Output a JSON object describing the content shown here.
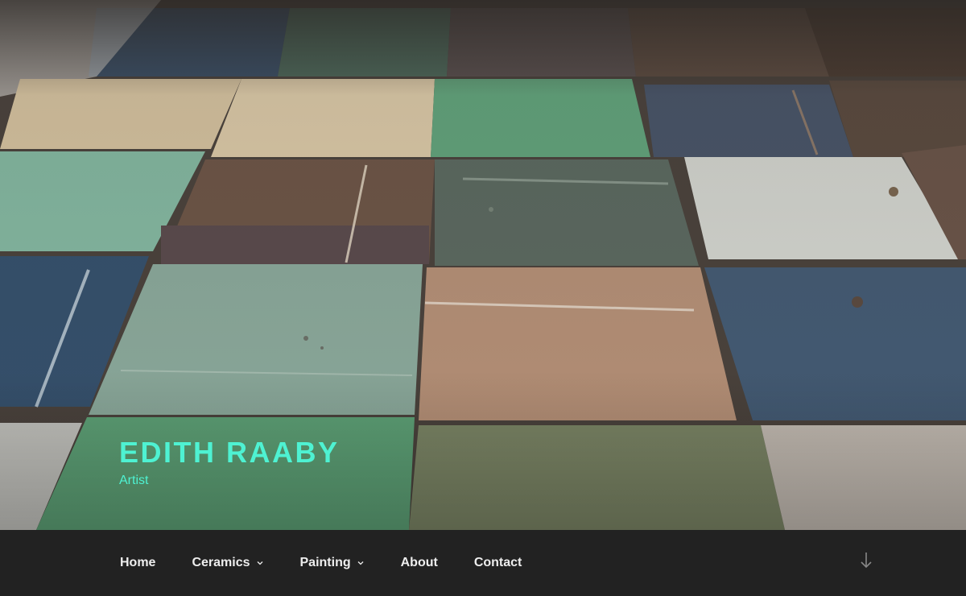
{
  "site": {
    "title": "EDITH RAABY",
    "tagline": "Artist"
  },
  "header_image": {
    "subject": "Glazed ceramic tiles",
    "colors": {
      "teal_green": "#5c9a78",
      "sea_green": "#7fb29a",
      "cream": "#d9c6a4",
      "brown": "#6e5546",
      "slate_blue": "#3e5670",
      "grey_green": "#5e6a5e",
      "sand": "#b08d75",
      "pale_grey": "#cfd2cc"
    }
  },
  "nav": {
    "items": [
      {
        "label": "Home",
        "has_submenu": false
      },
      {
        "label": "Ceramics",
        "has_submenu": true
      },
      {
        "label": "Painting",
        "has_submenu": true
      },
      {
        "label": "About",
        "has_submenu": false
      },
      {
        "label": "Contact",
        "has_submenu": false
      }
    ],
    "scroll_icon": "arrow-down-icon"
  },
  "colors": {
    "accent": "#4ef2d2",
    "nav_background": "#222222",
    "nav_text": "#eeeeee",
    "icon": "#888888"
  }
}
